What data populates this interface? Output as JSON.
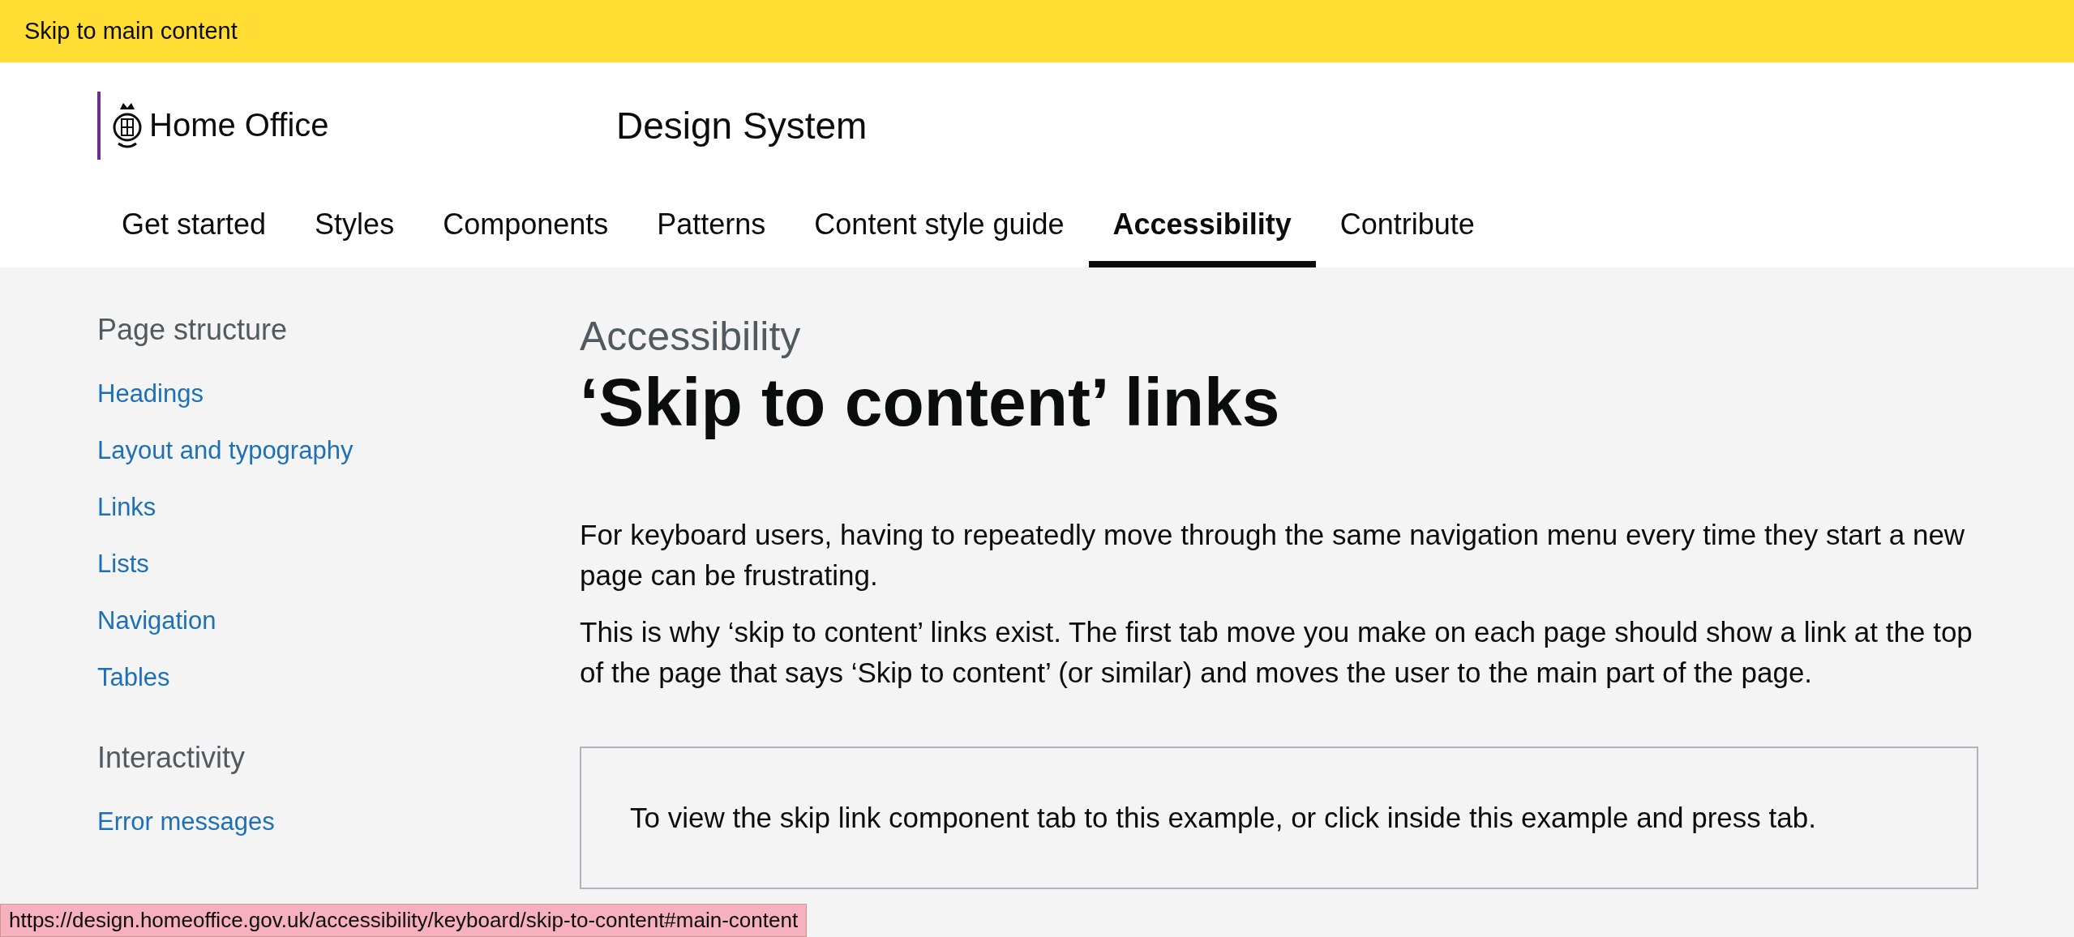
{
  "skip_link": "Skip to main content",
  "header": {
    "organisation": "Home Office",
    "service": "Design System"
  },
  "nav": [
    {
      "label": "Get started",
      "selected": false
    },
    {
      "label": "Styles",
      "selected": false
    },
    {
      "label": "Components",
      "selected": false
    },
    {
      "label": "Patterns",
      "selected": false
    },
    {
      "label": "Content style guide",
      "selected": false
    },
    {
      "label": "Accessibility",
      "selected": true
    },
    {
      "label": "Contribute",
      "selected": false
    }
  ],
  "sidebar": [
    {
      "heading": "Page structure",
      "items": [
        "Headings",
        "Layout and typography",
        "Links",
        "Lists",
        "Navigation",
        "Tables"
      ]
    },
    {
      "heading": "Interactivity",
      "items": [
        "Error messages"
      ]
    }
  ],
  "main": {
    "caption": "Accessibility",
    "title": "‘Skip to content’ links",
    "paragraphs": [
      "For keyboard users, having to repeatedly move through the same navigation menu every time they start a new page can be frustrating.",
      "This is why ‘skip to content’ links exist. The first tab move you make on each page should show a link at the top of the page that says ‘Skip to content’ (or similar) and moves the user to the main part of the page."
    ],
    "example_text": "To view the skip link component tab to this example, or click inside this example and press tab."
  },
  "status_url": "https://design.homeoffice.gov.uk/accessibility/keyboard/skip-to-content#main-content"
}
